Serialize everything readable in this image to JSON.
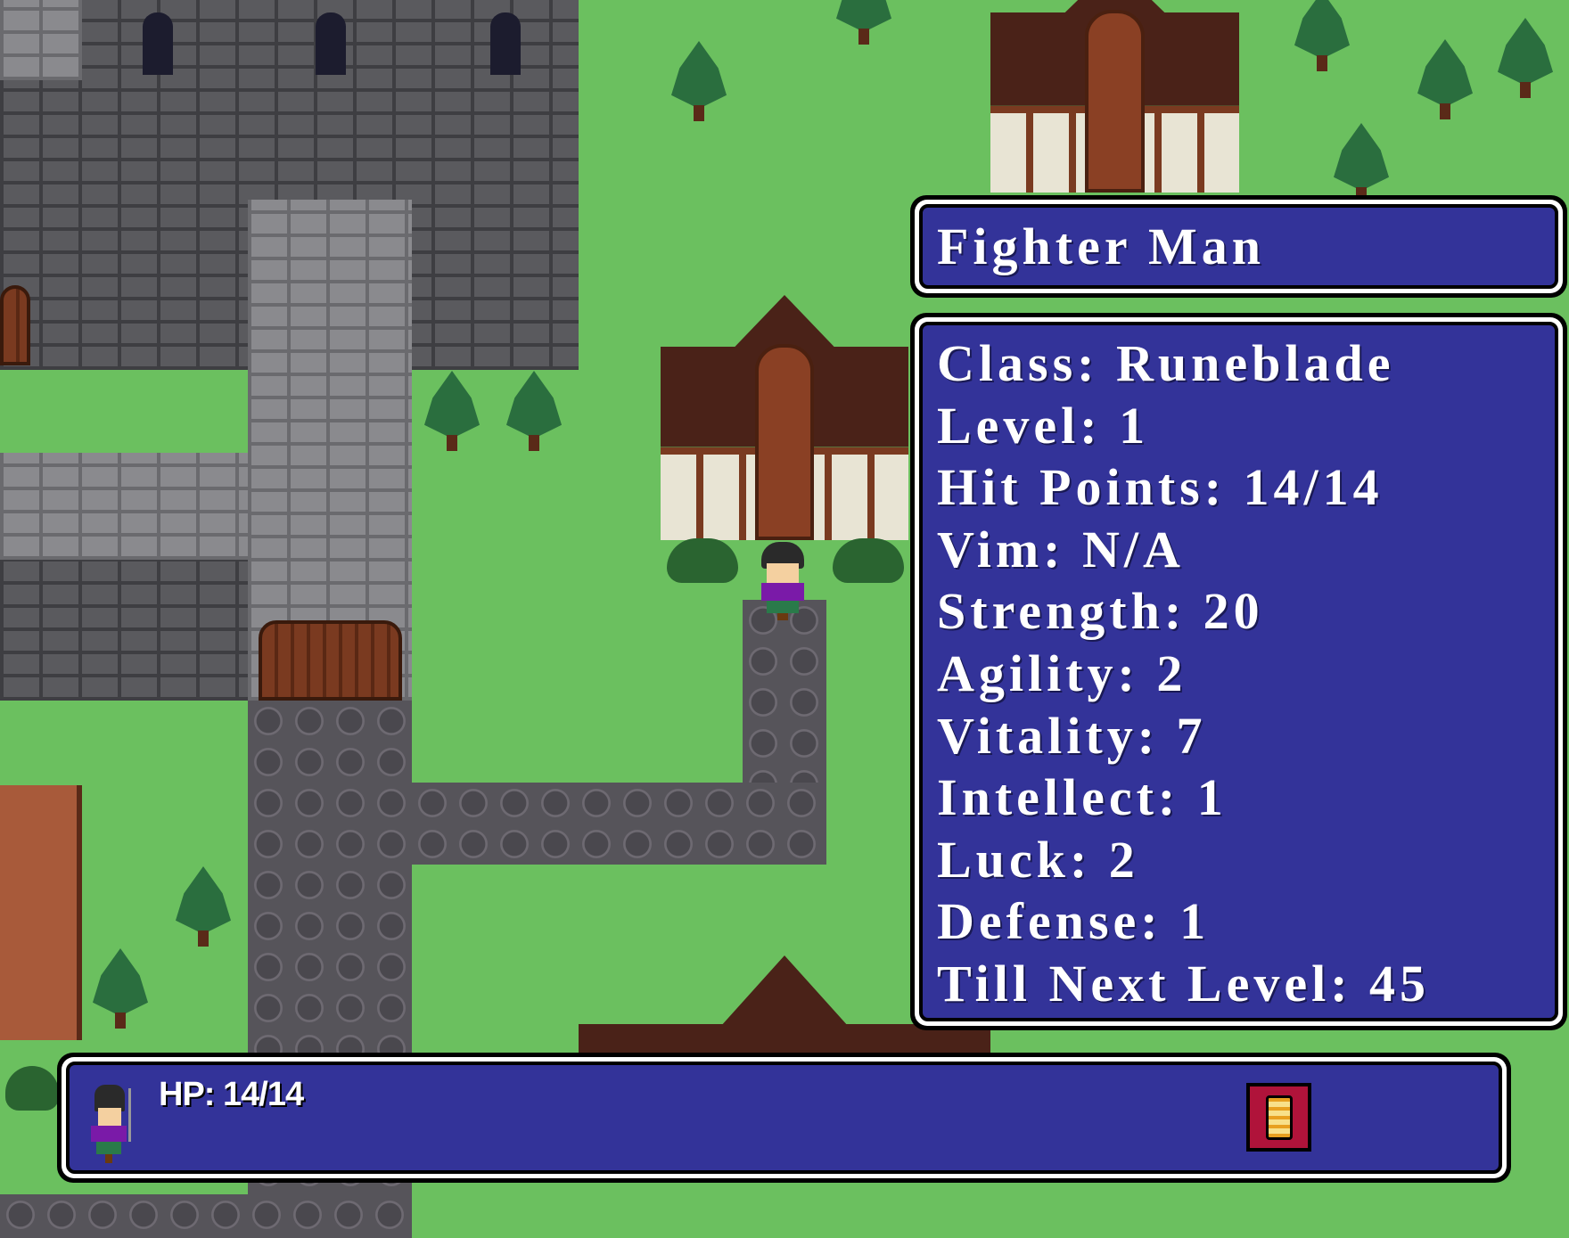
{
  "character": {
    "name": "Fighter Man"
  },
  "stats": [
    {
      "label": "Class: Runeblade"
    },
    {
      "label": "Level: 1"
    },
    {
      "label": "Hit Points: 14/14"
    },
    {
      "label": "Vim: N/A"
    },
    {
      "label": "Strength: 20"
    },
    {
      "label": "Agility: 2"
    },
    {
      "label": "Vitality: 7"
    },
    {
      "label": "Intellect: 1"
    },
    {
      "label": "Luck: 2"
    },
    {
      "label": "Defense: 1"
    },
    {
      "label": "Till Next Level: 45"
    }
  ],
  "party_bar": {
    "hp": "HP: 14/14",
    "item_icon": "scroll-icon"
  },
  "colors": {
    "panel": "#333399",
    "grass": "#6bc05f",
    "scroll_bg": "#b0133a"
  }
}
